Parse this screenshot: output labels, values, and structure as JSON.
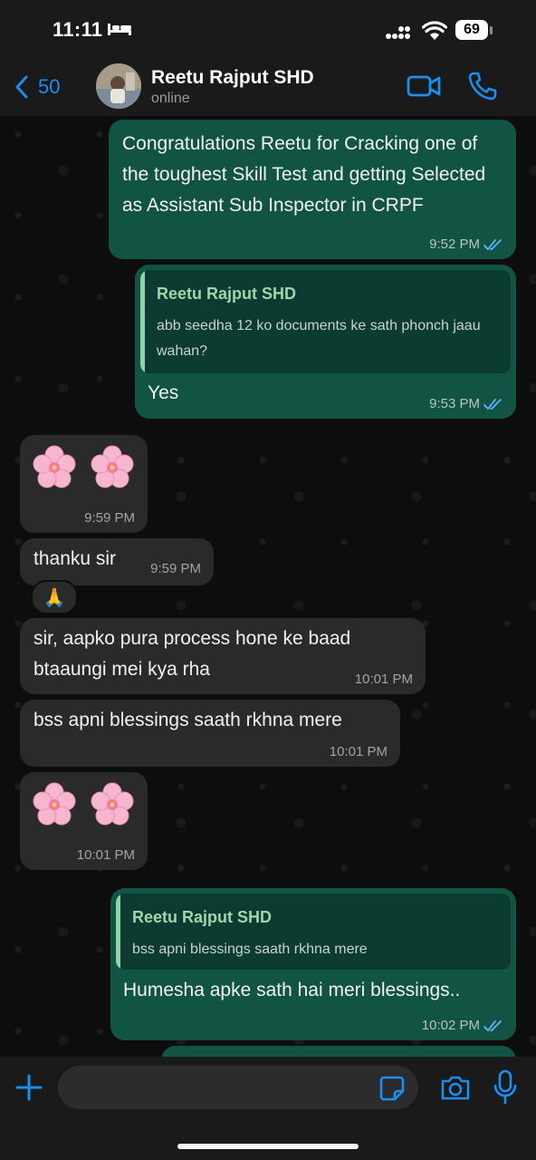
{
  "status_bar": {
    "time": "11:11",
    "battery": "69"
  },
  "header": {
    "back_count": "50",
    "contact_name": "Reetu Rajput SHD",
    "contact_status": "online"
  },
  "messages": [
    {
      "text": "Congratulations Reetu for Cracking one of the toughest Skill Test and getting Selected as Assistant Sub Inspector in CRPF",
      "time": "9:52 PM"
    },
    {
      "quote_name": "Reetu Rajput SHD",
      "quote_text": "abb seedha 12 ko documents ke sath phonch jaau wahan?",
      "text": "Yes",
      "time": "9:53 PM"
    },
    {
      "time": "9:59 PM"
    },
    {
      "text": "thanku sir",
      "time": "9:59 PM",
      "reaction": "🙏"
    },
    {
      "text": "sir, aapko pura process hone ke baad btaaungi mei kya rha",
      "time": "10:01 PM"
    },
    {
      "text": "bss apni blessings saath rkhna mere",
      "time": "10:01 PM"
    },
    {
      "time": "10:01 PM"
    },
    {
      "quote_name": "Reetu Rajput SHD",
      "quote_text": "bss apni blessings saath rkhna mere",
      "text": "Humesha apke sath hai meri blessings..",
      "time": "10:02 PM"
    }
  ],
  "input": {
    "placeholder": ""
  },
  "colors": {
    "accent": "#1b8ef2",
    "outgoing_bubble": "#125444",
    "incoming_bubble": "#2a2a2a",
    "quote_name": "#9fd6ae"
  }
}
